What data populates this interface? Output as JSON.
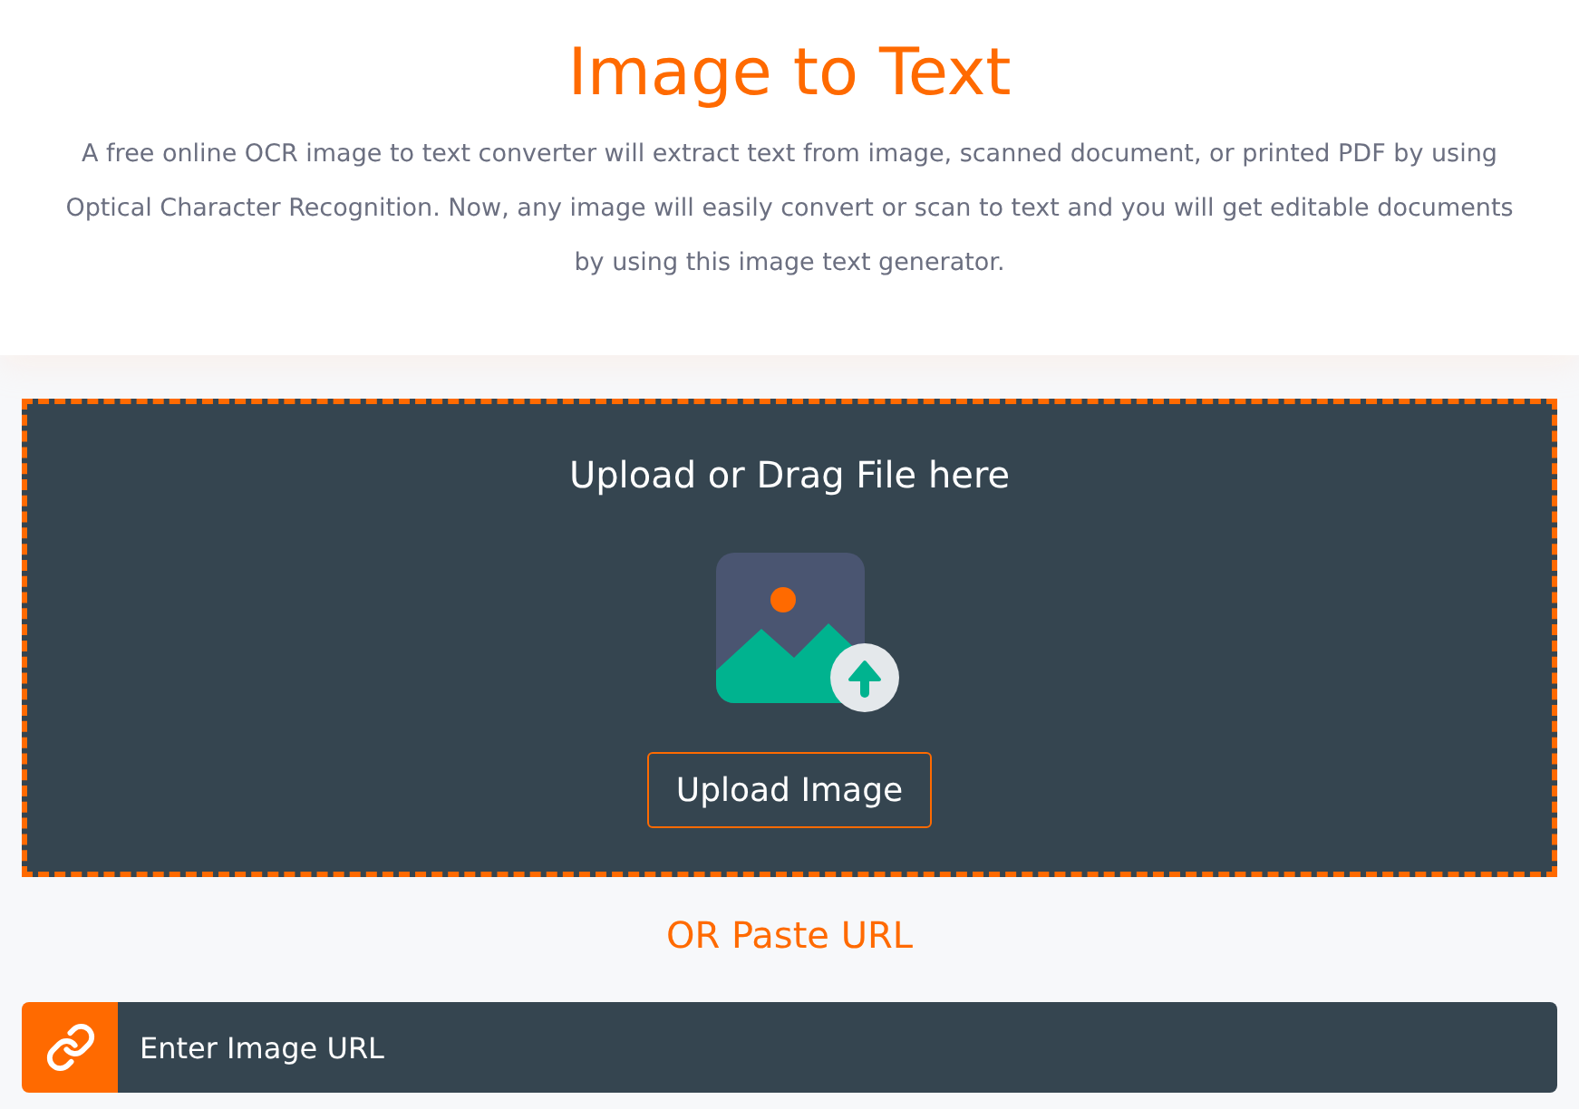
{
  "header": {
    "title": "Image to Text",
    "description": "A free online OCR image to text converter will extract text from image, scanned document, or printed PDF by using Optical Character Recognition. Now, any image will easily convert or scan to text and you will get editable documents by using this image text generator."
  },
  "upload": {
    "heading": "Upload or Drag File here",
    "button": "Upload Image"
  },
  "url": {
    "divider": "OR Paste URL",
    "placeholder": "Enter Image URL"
  }
}
